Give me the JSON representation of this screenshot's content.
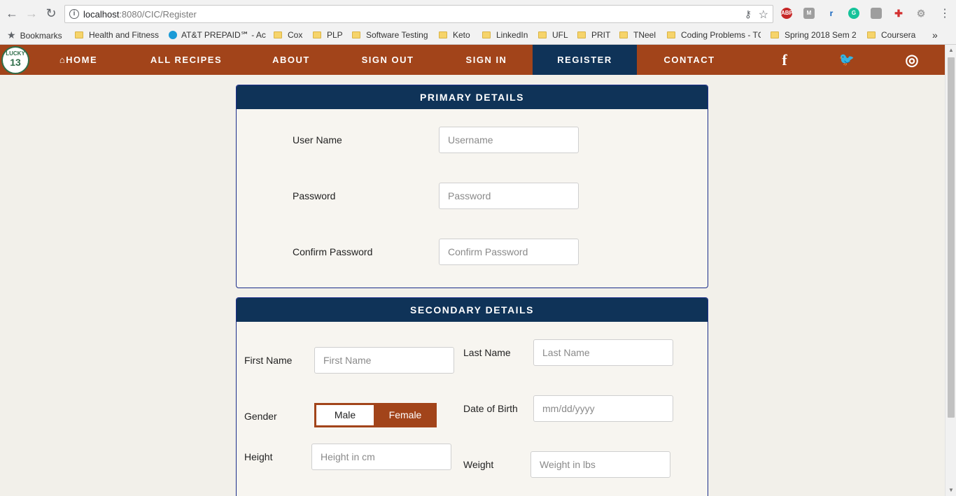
{
  "browser": {
    "url_host": "localhost",
    "url_rest": ":8080/CIC/Register",
    "bookmarks": [
      "Bookmarks",
      "Health and Fitness",
      "AT&T PREPAID℠ - Ac",
      "Cox",
      "PLP",
      "Software Testing",
      "Keto",
      "LinkedIn",
      "UFL",
      "PRIT",
      "TNeel",
      "Coding Problems - TC",
      "Spring 2018 Sem 2",
      "Coursera"
    ],
    "more_bookmarks": "»",
    "extensions": [
      "ABP",
      "M"
    ]
  },
  "nav": {
    "logo_top": "LUCKY",
    "logo_num": "13",
    "home": "HOME",
    "all_recipes": "ALL RECIPES",
    "about": "ABOUT",
    "sign_out": "SIGN OUT",
    "sign_in": "SIGN IN",
    "register": "REGISTER",
    "contact": "CONTACT",
    "social": {
      "facebook": "f",
      "twitter": "🐦",
      "instagram": "◎"
    }
  },
  "primary": {
    "title": "PRIMARY DETAILS",
    "username_label": "User Name",
    "username_placeholder": "Username",
    "password_label": "Password",
    "password_placeholder": "Password",
    "confirm_label": "Confirm Password",
    "confirm_placeholder": "Confirm Password"
  },
  "secondary": {
    "title": "SECONDARY DETAILS",
    "first_name_label": "First Name",
    "first_name_placeholder": "First Name",
    "last_name_label": "Last Name",
    "last_name_placeholder": "Last Name",
    "gender_label": "Gender",
    "gender_options": [
      "Male",
      "Female"
    ],
    "gender_selected": "Female",
    "dob_label": "Date of Birth",
    "dob_placeholder": "mm/dd/yyyy",
    "height_label": "Height",
    "height_placeholder": "Height in cm",
    "weight_label": "Weight",
    "weight_placeholder": "Weight in lbs"
  },
  "colors": {
    "nav_bg": "#a2441a",
    "panel_head": "#0f3358",
    "active_nav": "#0f3358"
  }
}
